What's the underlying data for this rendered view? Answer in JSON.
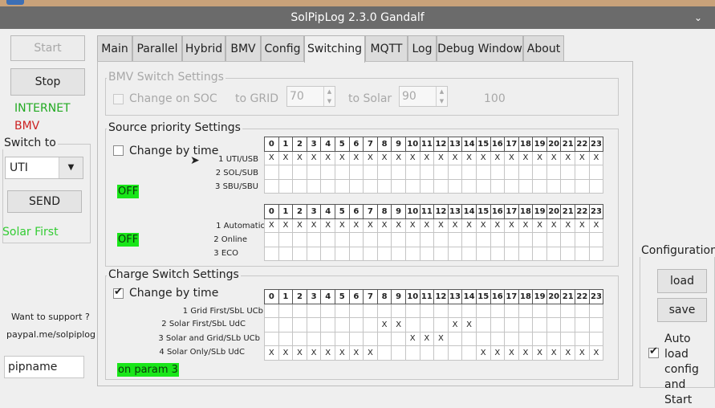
{
  "window": {
    "title": "SolPipLog 2.3.0 Gandalf"
  },
  "left": {
    "start": "Start",
    "stop": "Stop",
    "internet": "INTERNET",
    "bmv": "BMV",
    "switch_to": "Switch to",
    "combo_value": "UTI",
    "send": "SEND",
    "mode": "Solar First",
    "support": "Want to support ?",
    "paypal": "paypal.me/solpiplog",
    "user": "pipname"
  },
  "tabs": [
    "Main",
    "Parallel",
    "Hybrid",
    "BMV",
    "Config",
    "Switching",
    "MQTT",
    "Log",
    "Debug Window",
    "About"
  ],
  "bmv_switch": {
    "title": "BMV Switch Settings",
    "change_on_soc": "Change on SOC",
    "to_grid": "to GRID",
    "grid_value": "70",
    "to_solar": "to Solar",
    "solar_value": "90",
    "max": "100"
  },
  "source_priority": {
    "title": "Source priority Settings",
    "change_by_time": "Change by time",
    "status1": "OFF",
    "status2": "OFF",
    "hours": [
      "0",
      "1",
      "2",
      "3",
      "4",
      "5",
      "6",
      "7",
      "8",
      "9",
      "10",
      "11",
      "12",
      "13",
      "14",
      "15",
      "16",
      "17",
      "18",
      "19",
      "20",
      "21",
      "22",
      "23"
    ],
    "grid1": {
      "labels": [
        "1 UTI/USB",
        "2 SOL/SUB",
        "3 SBU/SBU"
      ],
      "marks": [
        [
          0,
          1,
          2,
          3,
          4,
          5,
          6,
          7,
          8,
          9,
          10,
          11,
          12,
          13,
          14,
          15,
          16,
          17,
          18,
          19,
          20,
          21,
          22,
          23
        ],
        [],
        []
      ]
    },
    "grid2": {
      "labels": [
        "1 Automatic",
        "2 Online",
        "3 ECO"
      ],
      "marks": [
        [
          0,
          1,
          2,
          3,
          4,
          5,
          6,
          7,
          8,
          9,
          10,
          11,
          12,
          13,
          14,
          15,
          16,
          17,
          18,
          19,
          20,
          21,
          22,
          23
        ],
        [],
        []
      ]
    }
  },
  "charge_switch": {
    "title": "Charge Switch Settings",
    "change_by_time": "Change by time",
    "status": "on param 3",
    "labels": [
      "1 Grid First/SbL UCb",
      "2 Solar First/SbL UdC",
      "3 Solar and Grid/SLb UCb",
      "4 Solar Only/SLb UdC"
    ],
    "marks": [
      [],
      [
        8,
        9,
        13,
        14
      ],
      [
        10,
        11,
        12
      ],
      [
        0,
        1,
        2,
        3,
        4,
        5,
        6,
        7,
        15,
        16,
        17,
        18,
        19,
        20,
        21,
        22,
        23
      ]
    ]
  },
  "configuration": {
    "title": "Configuration",
    "load": "load",
    "save": "save",
    "auto_load": "Auto load config and Start"
  }
}
